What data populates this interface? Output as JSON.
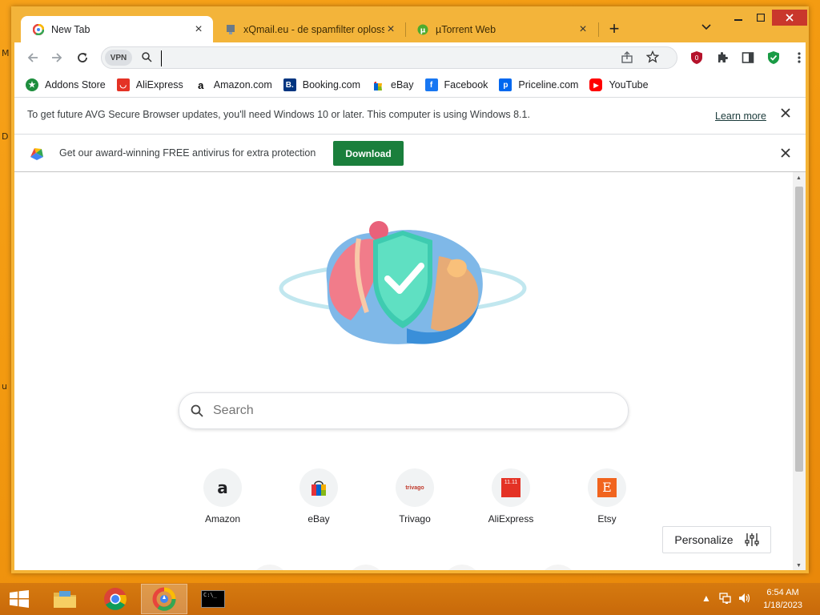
{
  "desktop": {
    "edge_letters": [
      "M",
      "D",
      "u"
    ]
  },
  "tabs": [
    {
      "title": "New Tab",
      "active": true
    },
    {
      "title": "xQmail.eu - de spamfilter oploss",
      "active": false
    },
    {
      "title": "µTorrent Web",
      "active": false
    }
  ],
  "toolbar": {
    "vpn_label": "VPN",
    "address_value": "",
    "ublock_badge": "0"
  },
  "bookmarks": [
    {
      "label": "Addons Store",
      "icon": "addons-store-icon",
      "color": "#1e8e3e"
    },
    {
      "label": "AliExpress",
      "icon": "aliexpress-icon",
      "color": "#e43225"
    },
    {
      "label": "Amazon.com",
      "icon": "amazon-icon",
      "color": "#000000"
    },
    {
      "label": "Booking.com",
      "icon": "booking-icon",
      "color": "#003580"
    },
    {
      "label": "eBay",
      "icon": "ebay-icon",
      "color": "#e53238"
    },
    {
      "label": "Facebook",
      "icon": "facebook-icon",
      "color": "#1877f2"
    },
    {
      "label": "Priceline.com",
      "icon": "priceline-icon",
      "color": "#0068ef"
    },
    {
      "label": "YouTube",
      "icon": "youtube-icon",
      "color": "#ff0000"
    }
  ],
  "update_bar": {
    "message": "To get future AVG Secure Browser updates, you'll need Windows 10 or later. This computer is using Windows 8.1.",
    "link": "Learn more"
  },
  "promo_bar": {
    "message": "Get our award-winning FREE antivirus for extra protection",
    "button": "Download",
    "button_color": "#1a7f3c"
  },
  "newtab": {
    "search_placeholder": "Search",
    "tiles": [
      {
        "label": "Amazon",
        "icon": "amazon-icon"
      },
      {
        "label": "eBay",
        "icon": "ebay-icon"
      },
      {
        "label": "Trivago",
        "icon": "trivago-icon",
        "logo_text": "trivago"
      },
      {
        "label": "AliExpress",
        "icon": "aliexpress-icon",
        "logo_text": "11.11"
      },
      {
        "label": "Etsy",
        "icon": "etsy-icon",
        "logo_text": "E"
      }
    ],
    "personalize": "Personalize"
  },
  "taskbar": {
    "time": "6:54 AM",
    "date": "1/18/2023",
    "cmd_text": "C:\\_"
  },
  "colors": {
    "accent_orange": "#f3b43a",
    "taskbar": "#c8690a",
    "avg_green": "#1a7f3c"
  }
}
